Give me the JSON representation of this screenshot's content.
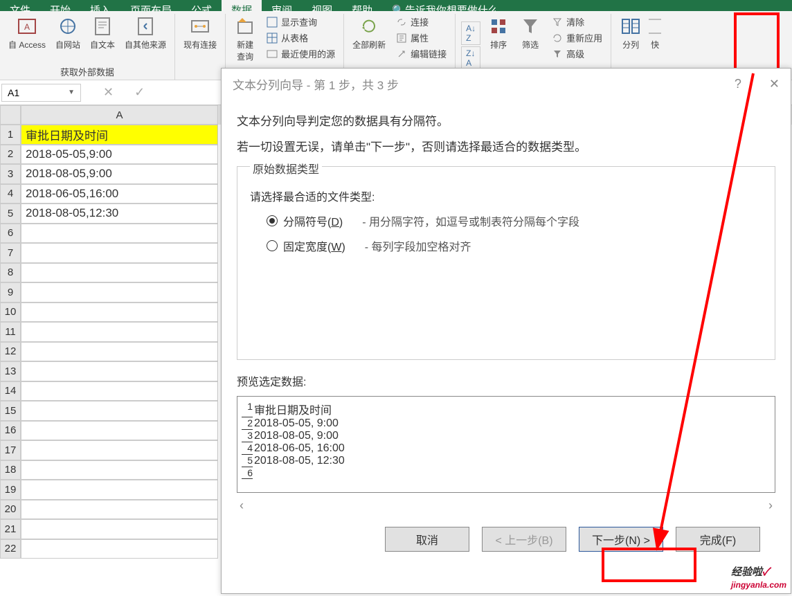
{
  "menu": {
    "tabs": [
      "文件",
      "开始",
      "插入",
      "页面布局",
      "公式",
      "数据",
      "审阅",
      "视图",
      "帮助"
    ],
    "active_index": 5,
    "search_hint": "告诉我你想要做什么"
  },
  "ribbon": {
    "group1_label": "获取外部数据",
    "btn_access": "自 Access",
    "btn_web": "自网站",
    "btn_text": "自文本",
    "btn_other": "自其他来源",
    "btn_conn": "现有连接",
    "btn_newquery": "新建\n查询",
    "small_show_query": "显示查询",
    "small_from_table": "从表格",
    "small_recent": "最近使用的源",
    "btn_refresh": "全部刷新",
    "small_connections": "连接",
    "small_properties": "属性",
    "small_edit_links": "编辑链接",
    "btn_sort_az": "A↓Z",
    "btn_sort_za": "Z↓A",
    "btn_sort": "排序",
    "btn_filter": "筛选",
    "small_clear": "清除",
    "small_reapply": "重新应用",
    "small_advanced": "高级",
    "btn_split": "分列",
    "btn_quick": "快"
  },
  "formula": {
    "namebox": "A1"
  },
  "sheet": {
    "col_a": "A",
    "header_row": "审批日期及时间",
    "rows": [
      "2018-05-05,9:00",
      "2018-08-05,9:00",
      "2018-06-05,16:00",
      "2018-08-05,12:30"
    ]
  },
  "dialog": {
    "title": "文本分列向导 - 第 1 步，共 3 步",
    "help_icon": "?",
    "line1": "文本分列向导判定您的数据具有分隔符。",
    "line2": "若一切设置无误，请单击\"下一步\"，否则请选择最适合的数据类型。",
    "legend": "原始数据类型",
    "field_label": "请选择最合适的文件类型:",
    "radio1_label": "分隔符号",
    "radio1_key": "D",
    "radio1_desc": "- 用分隔字符，如逗号或制表符分隔每个字段",
    "radio2_label": "固定宽度",
    "radio2_key": "W",
    "radio2_desc": "- 每列字段加空格对齐",
    "preview_label": "预览选定数据:",
    "preview": [
      "审批日期及时间",
      "2018-05-05, 9:00",
      "2018-08-05, 9:00",
      "2018-06-05, 16:00",
      "2018-08-05, 12:30",
      ""
    ],
    "btn_cancel": "取消",
    "btn_back": "< 上一步(B)",
    "btn_next": "下一步(N) >",
    "btn_finish": "完成(F)"
  },
  "watermark": {
    "text1": "经验啦",
    "text2": "jingyanla.com"
  },
  "annotation": {
    "red_box_split": "分列 highlight",
    "red_box_next": "下一步 highlight"
  }
}
